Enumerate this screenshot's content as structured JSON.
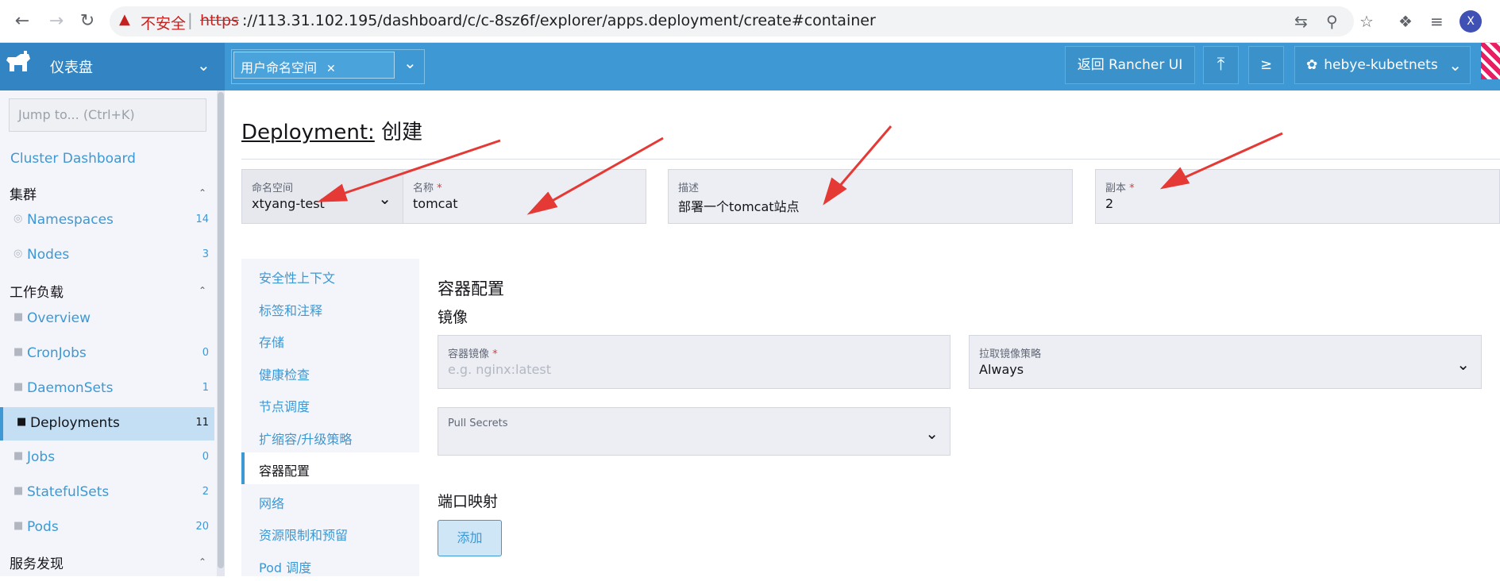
{
  "browser": {
    "security_warning": "不安全",
    "url_scheme": "https",
    "url_rest": "://113.31.102.195/dashboard/c/c-8sz6f/explorer/apps.deployment/create#container",
    "profile_initial": "X"
  },
  "header": {
    "brand_title": "仪表盘",
    "namespace_chip": "用户命名空间",
    "back_button": "返回 Rancher UI",
    "cluster_name": "hebye-kubetnets"
  },
  "sidebar": {
    "jump_placeholder": "Jump to... (Ctrl+K)",
    "cluster_dashboard": "Cluster Dashboard",
    "groups": {
      "cluster": "集群",
      "workload": "工作负载",
      "service_discovery": "服务发现"
    },
    "items": [
      {
        "label": "Namespaces",
        "count": "14"
      },
      {
        "label": "Nodes",
        "count": "3"
      },
      {
        "label": "Overview",
        "count": ""
      },
      {
        "label": "CronJobs",
        "count": "0"
      },
      {
        "label": "DaemonSets",
        "count": "1"
      },
      {
        "label": "Deployments",
        "count": "11"
      },
      {
        "label": "Jobs",
        "count": "0"
      },
      {
        "label": "StatefulSets",
        "count": "2"
      },
      {
        "label": "Pods",
        "count": "20"
      }
    ]
  },
  "page": {
    "title_link": "Deployment:",
    "title_action": "创建",
    "namespace_label": "命名空间",
    "namespace_value": "xtyang-test",
    "name_label": "名称",
    "name_value": "tomcat",
    "desc_label": "描述",
    "desc_value": "部署一个tomcat站点",
    "replicas_label": "副本",
    "replicas_value": "2",
    "required_mark": "*"
  },
  "tabs": [
    "安全性上下文",
    "标签和注释",
    "存储",
    "健康检查",
    "节点调度",
    "扩缩容/升级策略",
    "容器配置",
    "网络",
    "资源限制和预留",
    "Pod 调度"
  ],
  "container": {
    "section_title": "容器配置",
    "image_heading": "镜像",
    "image_label": "容器镜像",
    "image_placeholder": "e.g. nginx:latest",
    "pull_policy_label": "拉取镜像策略",
    "pull_policy_value": "Always",
    "pull_secrets_label": "Pull Secrets",
    "ports_heading": "端口映射",
    "add_button": "添加"
  },
  "colors": {
    "accent": "#3d98d3",
    "header_dark": "#3285c2",
    "annotation_arrow": "#e53935"
  }
}
